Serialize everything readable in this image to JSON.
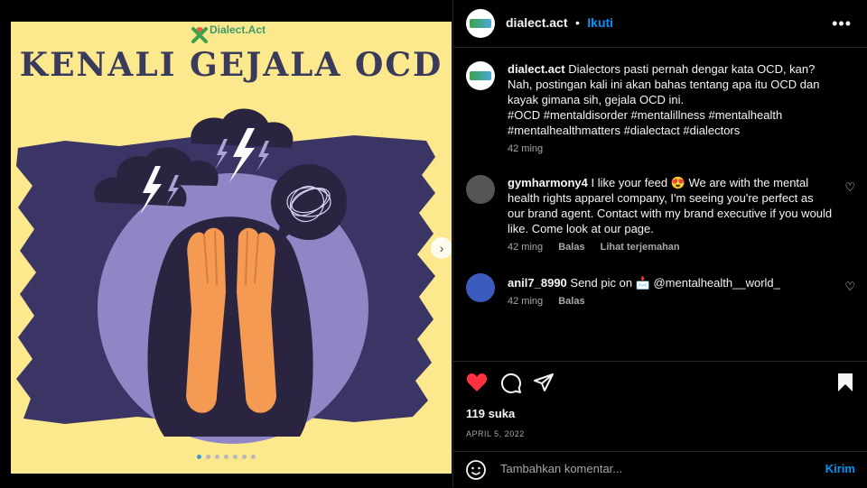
{
  "post": {
    "brand_name": "Dialect.Act",
    "headline": "KENALI GEJALA OCD",
    "carousel_total": 7,
    "carousel_active": 1
  },
  "header": {
    "username": "dialect.act",
    "separator": "•",
    "follow_label": "Ikuti",
    "more_icon": "more-horizontal-icon"
  },
  "caption": {
    "username": "dialect.act",
    "text": "Dialectors pasti pernah dengar kata OCD, kan? Nah, postingan kali ini akan bahas tentang apa itu OCD dan kayak gimana sih, gejala OCD ini.",
    "hashtags": "#OCD #mentaldisorder #mentalillness #mentalhealth #mentalhealthmatters #dialectact #dialectors",
    "time": "42 ming"
  },
  "comments": [
    {
      "username": "gymharmony4",
      "text": "I like your feed 😍 We are with the mental health rights apparel company, I'm seeing you're perfect as our brand agent. Contact with my brand executive if you would like. Come look at our page.",
      "time": "42 ming",
      "reply_label": "Balas",
      "translate_label": "Lihat terjemahan"
    },
    {
      "username": "anil7_8990",
      "text": "Send pic on 📩 @mentalhealth__world_",
      "time": "42 ming",
      "reply_label": "Balas"
    }
  ],
  "actions": {
    "likes": "119 suka",
    "date": "APRIL 5, 2022"
  },
  "comment_bar": {
    "placeholder": "Tambahkan komentar...",
    "post_label": "Kirim"
  },
  "colors": {
    "background": "#000000",
    "image_bg": "#fce88d",
    "brush": "#3b3566",
    "circle": "#8f86c6",
    "skin": "#f49a52",
    "link_blue": "#0095f6",
    "like_red": "#ff3040"
  }
}
